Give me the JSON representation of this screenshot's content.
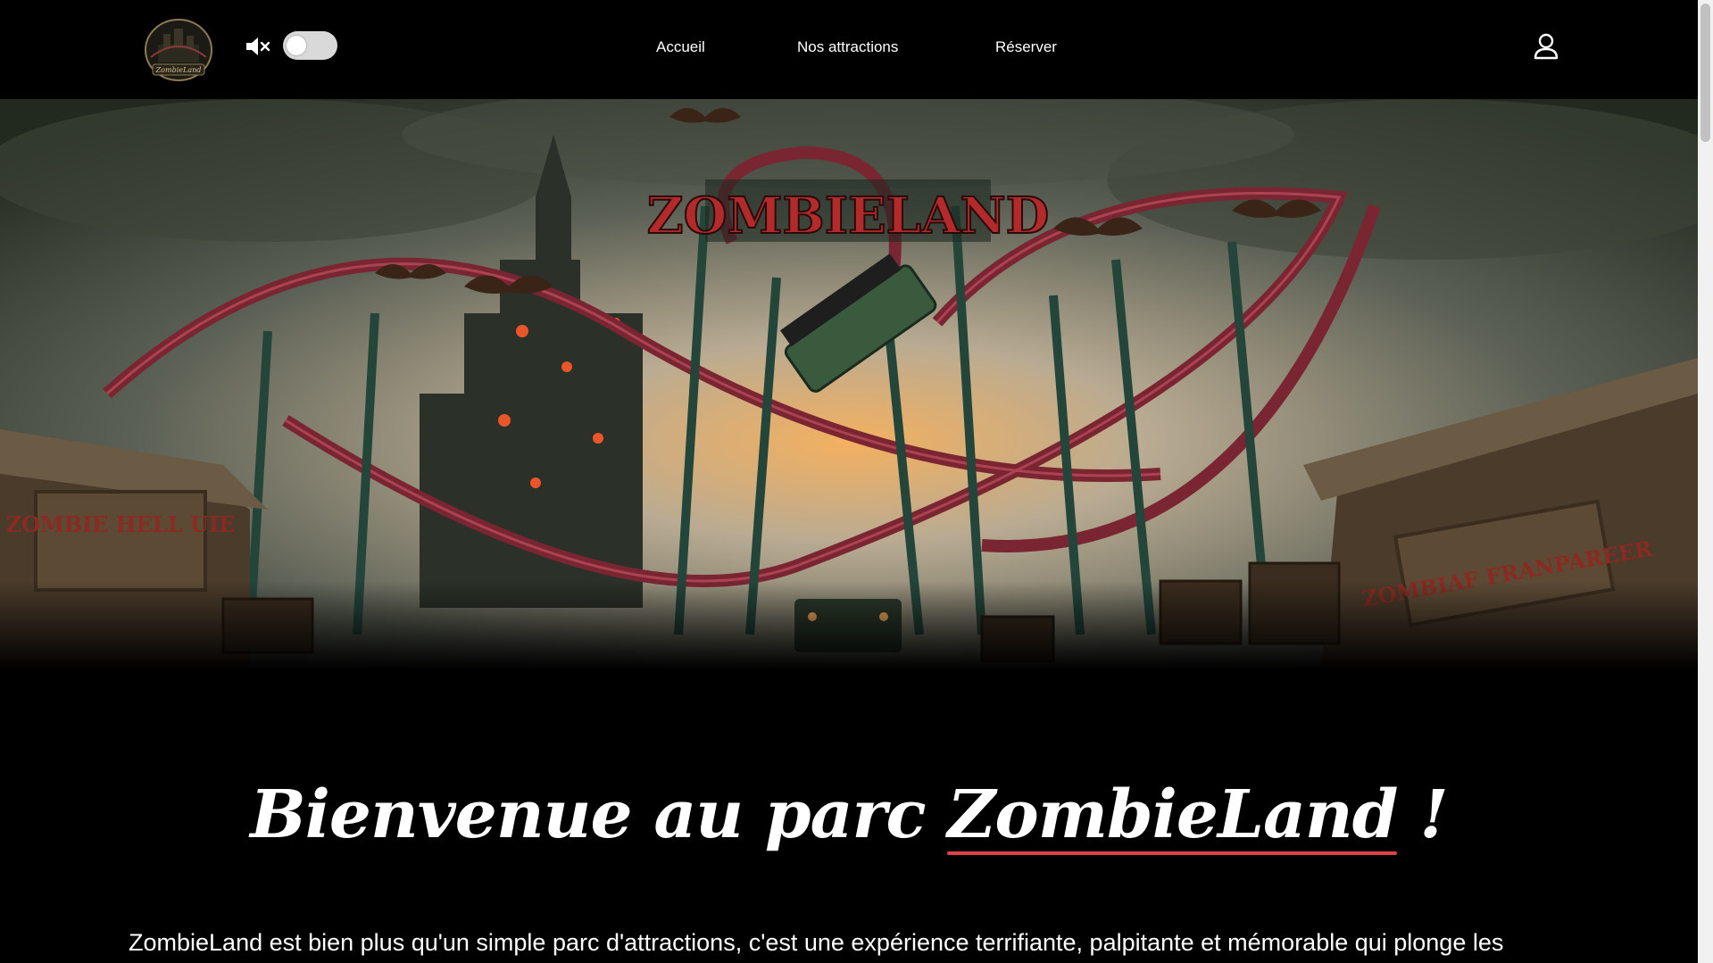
{
  "header": {
    "logo_text": "ZombieLand",
    "nav": [
      {
        "label": "Accueil"
      },
      {
        "label": "Nos attractions"
      },
      {
        "label": "Réserver"
      }
    ],
    "sound_toggle": {
      "muted": true,
      "enabled": false
    }
  },
  "hero": {
    "sign_text": "ZOMBIELAND",
    "left_sign": "ZOMBIE HELL UIE",
    "right_sign": "ZOMBIAF FRANPAREER"
  },
  "main": {
    "welcome_prefix": "Bienvenue au parc ",
    "welcome_brand": "ZombieLand",
    "welcome_suffix": " !",
    "intro": "ZombieLand est bien plus qu'un simple parc d'attractions, c'est une expérience terrifiante, palpitante et mémorable qui plonge les visiteurs au cœur d'un univers post-apocalyptique où les zombies règnent en maîtres. Conçu pour les"
  },
  "colors": {
    "background": "#000000",
    "accent_underline": "#e0424a",
    "toggle_track": "#d9d9d9"
  }
}
